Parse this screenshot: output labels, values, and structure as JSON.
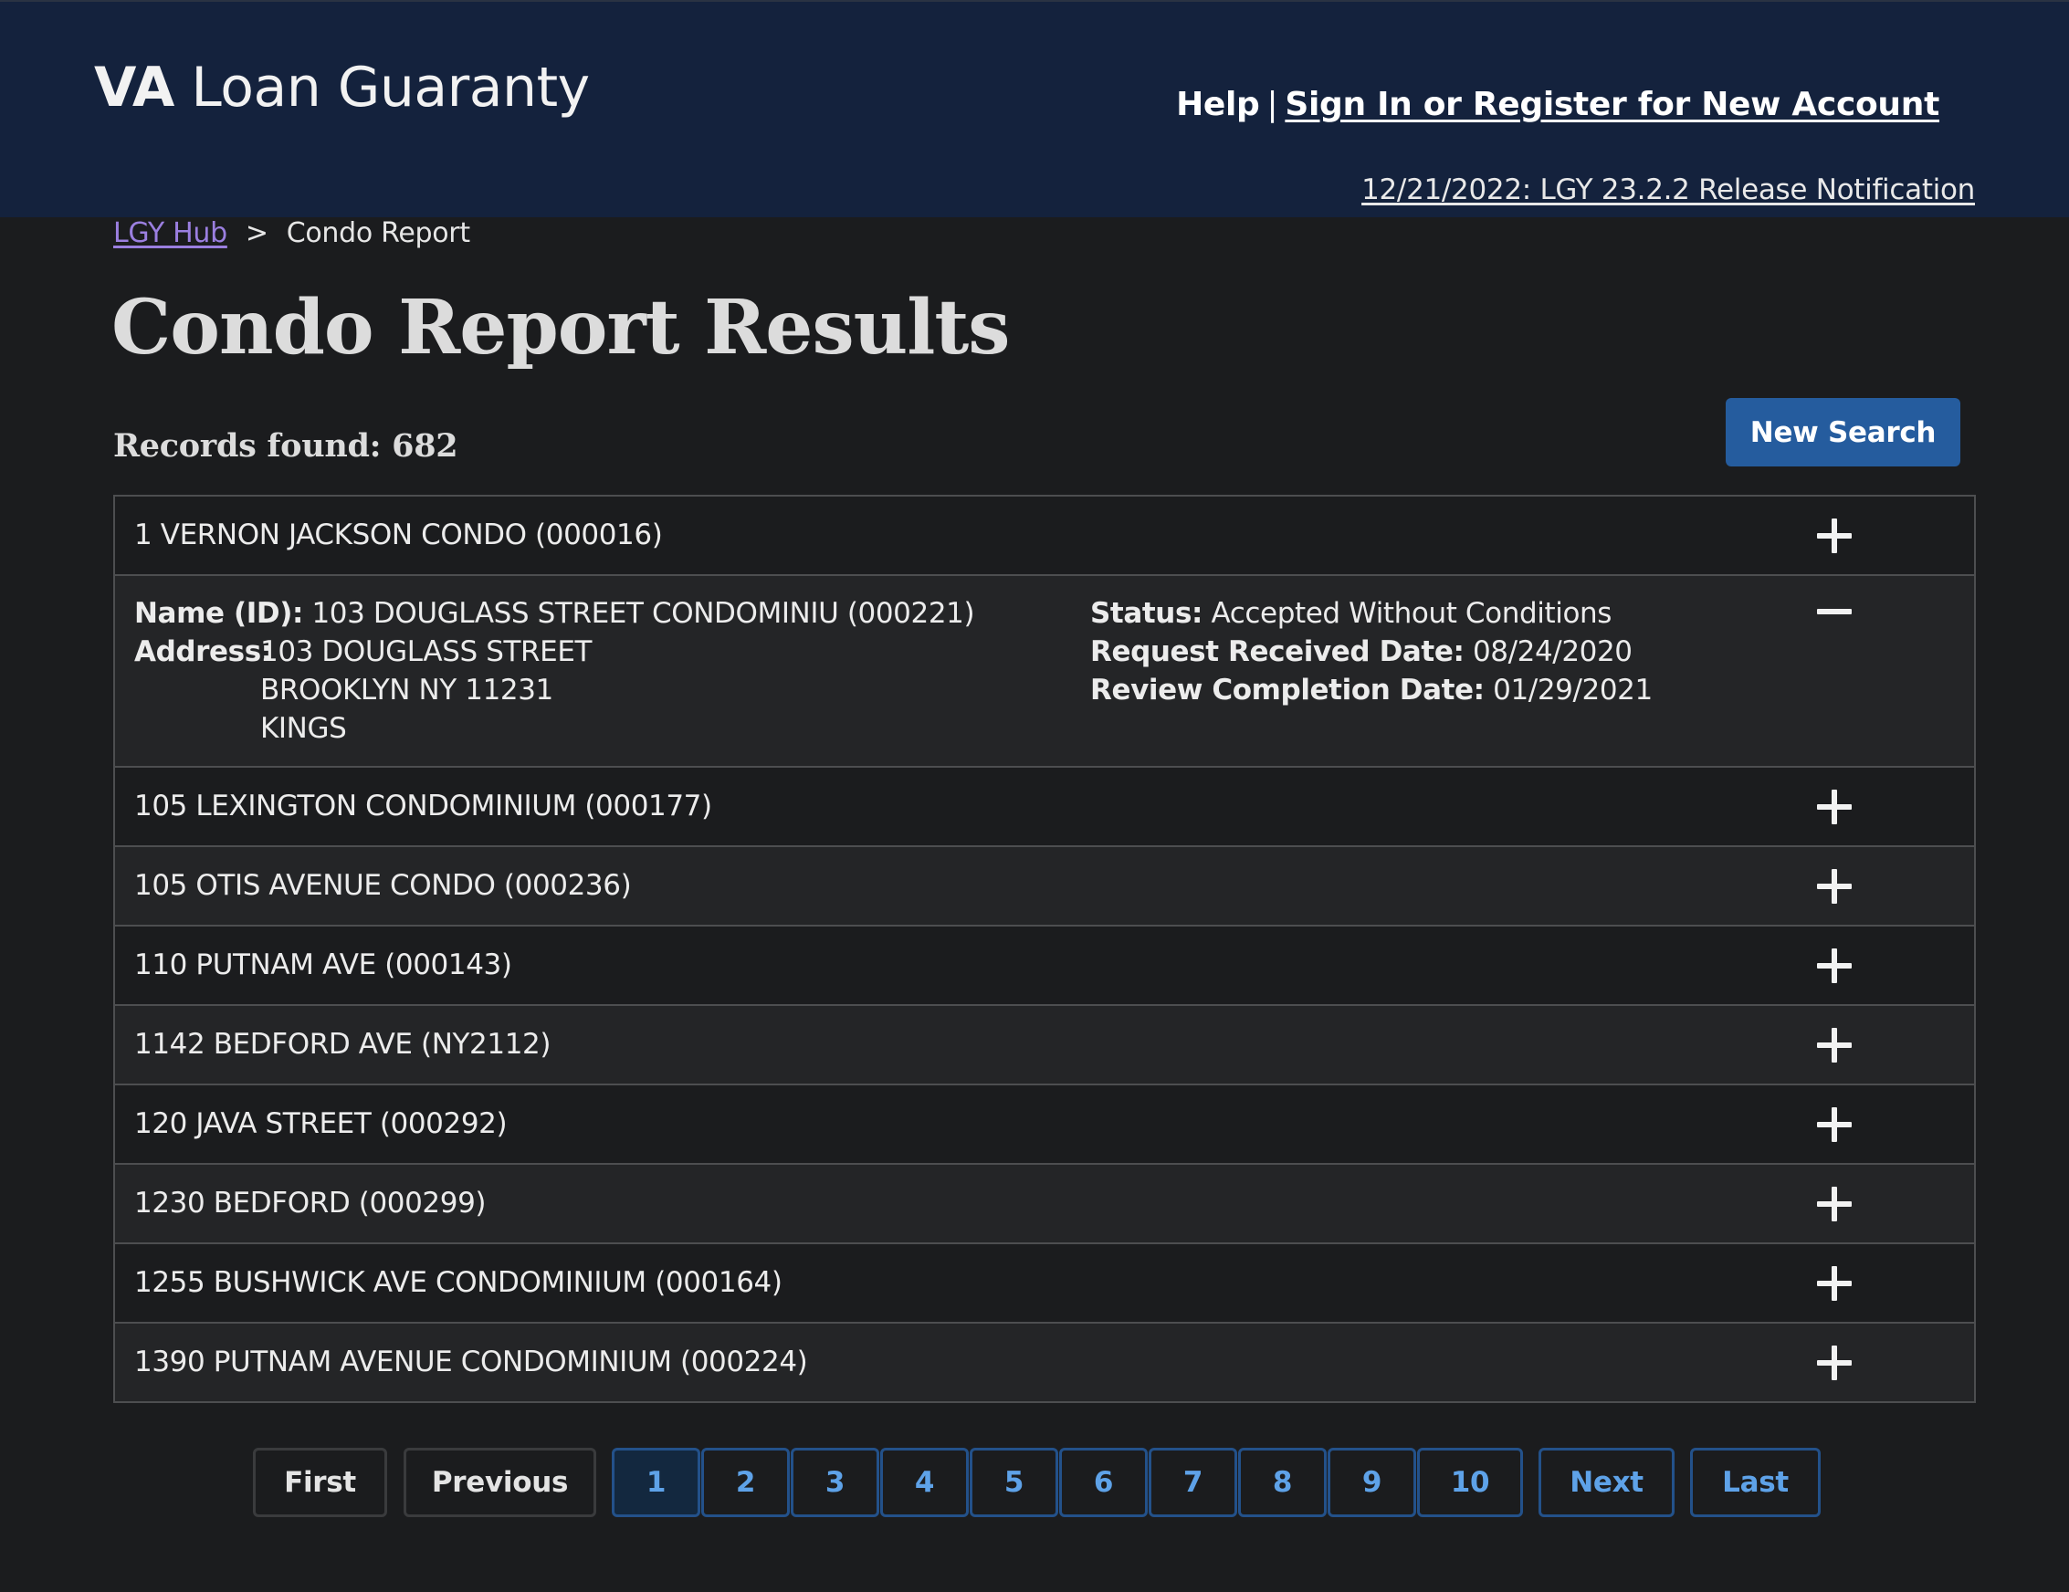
{
  "header": {
    "brand_bold": "VA",
    "brand_rest": " Loan Guaranty",
    "help_label": "Help",
    "separator": "|",
    "signin_label": "Sign In or Register for New Account",
    "release_label": "12/21/2022: LGY 23.2.2 Release Notification"
  },
  "breadcrumb": {
    "home_label": "LGY Hub",
    "separator": ">",
    "current": "Condo Report"
  },
  "page": {
    "title": "Condo Report Results",
    "records_label": "Records found: 682",
    "new_search_label": "New Search"
  },
  "results": [
    {
      "title": "1 VERNON JACKSON CONDO (000016)",
      "icon": "plus-icon"
    },
    {
      "expanded": true,
      "icon": "minus-icon",
      "name_label": "Name (ID):",
      "name_value": " 103 DOUGLASS STREET CONDOMINIU (000221)",
      "address_label": "Address:",
      "address_lines": [
        "103 DOUGLASS STREET",
        "BROOKLYN NY 11231",
        "KINGS"
      ],
      "status_label": "Status:",
      "status_value": " Accepted Without Conditions",
      "received_label": "Request Received Date:",
      "received_value": " 08/24/2020",
      "completion_label": "Review Completion Date:",
      "completion_value": " 01/29/2021"
    },
    {
      "title": "105 LEXINGTON CONDOMINIUM (000177)",
      "icon": "plus-icon"
    },
    {
      "title": "105 OTIS AVENUE CONDO (000236)",
      "icon": "plus-icon"
    },
    {
      "title": "110 PUTNAM AVE (000143)",
      "icon": "plus-icon"
    },
    {
      "title": "1142 BEDFORD AVE (NY2112)",
      "icon": "plus-icon"
    },
    {
      "title": "120 JAVA STREET (000292)",
      "icon": "plus-icon"
    },
    {
      "title": "1230 BEDFORD (000299)",
      "icon": "plus-icon"
    },
    {
      "title": "1255 BUSHWICK AVE CONDOMINIUM (000164)",
      "icon": "plus-icon"
    },
    {
      "title": "1390 PUTNAM AVENUE CONDOMINIUM (000224)",
      "icon": "plus-icon"
    }
  ],
  "pagination": {
    "first": "First",
    "previous": "Previous",
    "pages": [
      "1",
      "2",
      "3",
      "4",
      "5",
      "6",
      "7",
      "8",
      "9",
      "10"
    ],
    "current_page": "1",
    "next": "Next",
    "last": "Last"
  },
  "colors": {
    "header_bg": "#14223d",
    "page_bg": "#1b1c1e",
    "accent_button": "#255c9e",
    "link_visited": "#9b7fe0",
    "page_number_text": "#5ea2e8"
  }
}
